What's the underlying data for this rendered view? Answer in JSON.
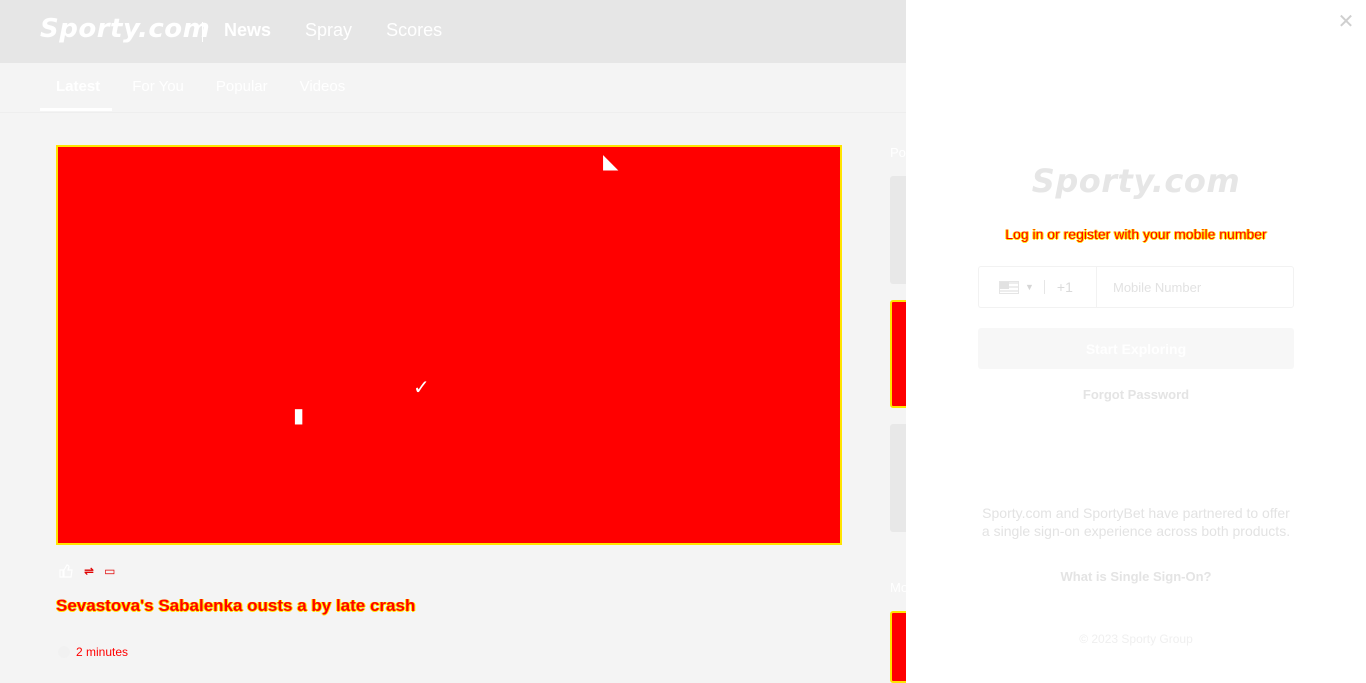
{
  "header": {
    "logo": "Sporty.com",
    "nav": [
      "News",
      "Spray",
      "Scores"
    ],
    "active_nav": "News"
  },
  "subnav": {
    "tabs": [
      "Latest",
      "For You",
      "Popular",
      "Videos"
    ],
    "active_tab": "Latest"
  },
  "article": {
    "headline": "Sevastova's Sabalenka ousts a by late crash",
    "time": "2 minutes",
    "icons": [
      "like-icon",
      "share-icon",
      "bookmark-icon"
    ]
  },
  "rail": {
    "title": "Po",
    "more_title": "Mo"
  },
  "modal": {
    "logo": "Sporty.com",
    "prompt": "Log in or register with your mobile number",
    "country_code": "+1",
    "country_flag": "us-flag-icon",
    "phone_placeholder": "Mobile Number",
    "start_button": "Start Exploring",
    "forgot_password": "Forgot Password",
    "partner_text": "Sporty.com and SportyBet have partnered to offer a single sign-on experience across both products.",
    "sso_link": "What is Single Sign-On?",
    "copyright": "© 2023 Sporty Group",
    "close_icon": "close-icon"
  },
  "colors": {
    "highlight_fill": "#ff0000",
    "highlight_border": "#ffe400",
    "modal_bg": "#ffffff",
    "overlay_bg": "#f4f4f4"
  }
}
